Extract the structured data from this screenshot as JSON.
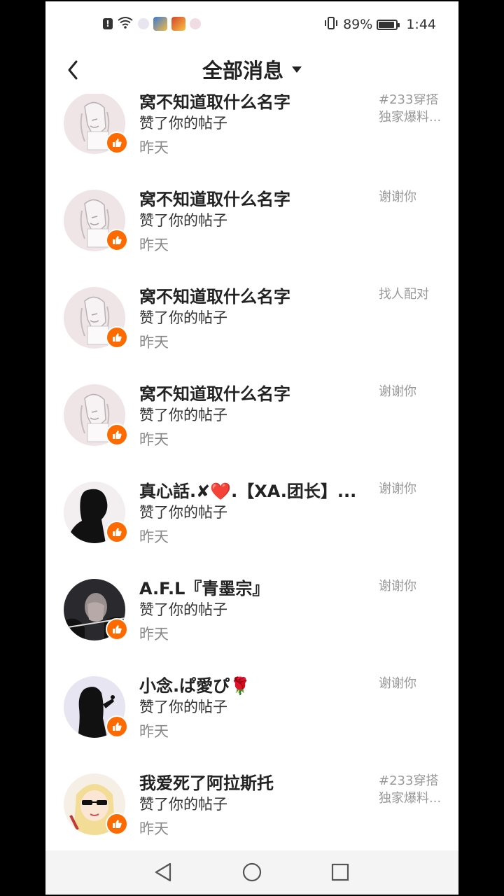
{
  "status_bar": {
    "icons": [
      "alert-icon",
      "wifi-icon",
      "app-icon",
      "game-icon",
      "game-icon-2",
      "app-icon-2"
    ],
    "vibrate_icon": "vibrate-icon",
    "battery_percent": "89%",
    "battery_level": 0.89,
    "time": "1:44"
  },
  "header": {
    "back_icon": "back-arrow-icon",
    "title": "全部消息",
    "dropdown_icon": "caret-down-icon"
  },
  "notifications": [
    {
      "name": "窝不知道取什么名字",
      "action": "赞了你的帖子",
      "time": "昨天",
      "post_line1": "#233穿搭",
      "post_line2": "独家爆料...",
      "avatar": "anime-girl-sketch"
    },
    {
      "name": "窝不知道取什么名字",
      "action": "赞了你的帖子",
      "time": "昨天",
      "post_line1": "谢谢你",
      "post_line2": "",
      "avatar": "anime-girl-sketch"
    },
    {
      "name": "窝不知道取什么名字",
      "action": "赞了你的帖子",
      "time": "昨天",
      "post_line1": "找人配对",
      "post_line2": "",
      "avatar": "anime-girl-sketch"
    },
    {
      "name": "窝不知道取什么名字",
      "action": "赞了你的帖子",
      "time": "昨天",
      "post_line1": "谢谢你",
      "post_line2": "",
      "avatar": "anime-girl-sketch"
    },
    {
      "name": "真心話.✘❤️.【XA.团长】...",
      "action": "赞了你的帖子",
      "time": "昨天",
      "post_line1": "谢谢你",
      "post_line2": "",
      "avatar": "silhouette"
    },
    {
      "name": "A.F.L『青墨宗』",
      "action": "赞了你的帖子",
      "time": "昨天",
      "post_line1": "谢谢你",
      "post_line2": "",
      "avatar": "photo-dark"
    },
    {
      "name": "小念.ぱ愛ぴ🌹",
      "action": "赞了你的帖子",
      "time": "昨天",
      "post_line1": "谢谢你",
      "post_line2": "",
      "avatar": "girl-silhouette"
    },
    {
      "name": "我爱死了阿拉斯托",
      "action": "赞了你的帖子",
      "time": "昨天",
      "post_line1": "#233穿搭",
      "post_line2": "独家爆料...",
      "avatar": "anime-blonde"
    }
  ],
  "nav_bar": {
    "back_icon": "nav-back-icon",
    "home_icon": "nav-home-icon",
    "recents_icon": "nav-recents-icon"
  },
  "colors": {
    "like_badge": "#ff6a00",
    "background": "#ffffff",
    "frame": "#000000",
    "nav_bar": "#f4f4f4"
  }
}
